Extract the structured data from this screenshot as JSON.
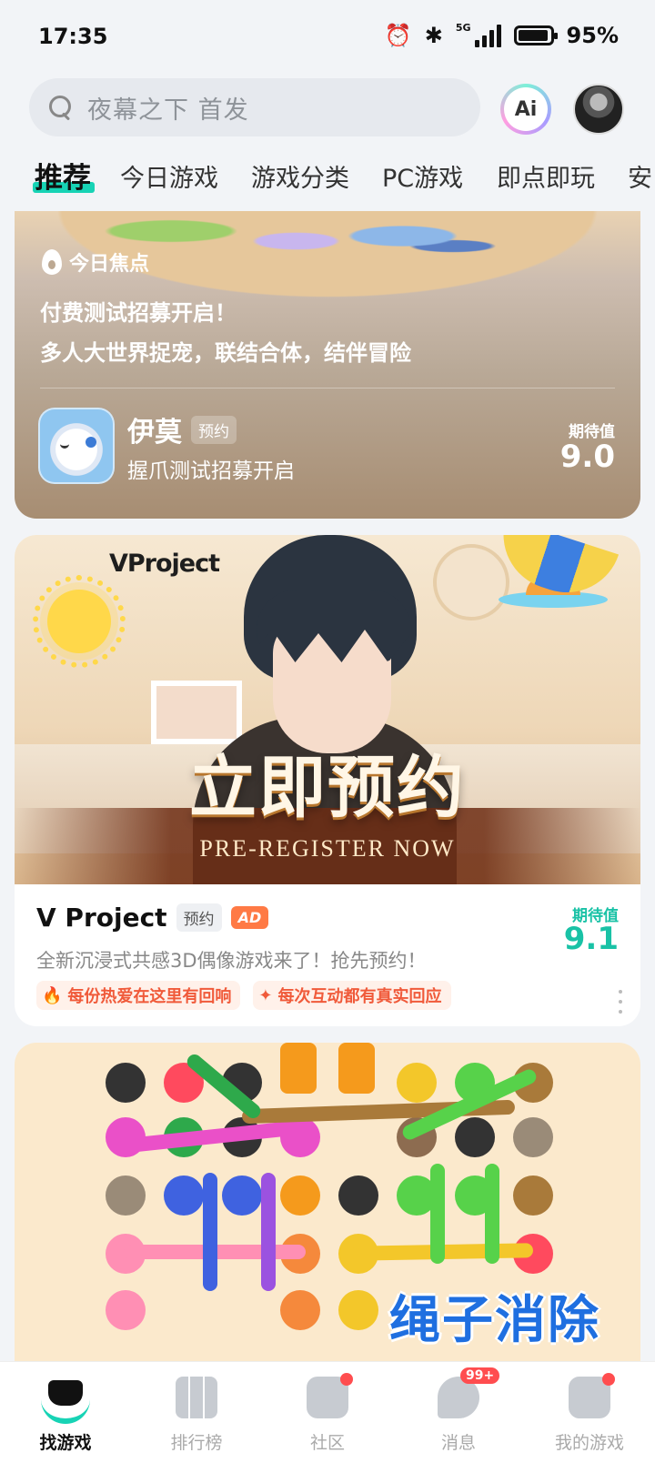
{
  "status_bar": {
    "time": "17:35",
    "network": "5G",
    "battery": "95%",
    "icons": [
      "alarm-icon",
      "bluetooth-icon",
      "signal-icon",
      "battery-icon"
    ]
  },
  "header": {
    "search_placeholder": "夜幕之下 首发",
    "ai_label": "Ai"
  },
  "tabs": [
    {
      "label": "推荐",
      "active": true
    },
    {
      "label": "今日游戏"
    },
    {
      "label": "游戏分类"
    },
    {
      "label": "PC游戏"
    },
    {
      "label": "即点即玩"
    },
    {
      "label": "安"
    }
  ],
  "spotlight_card": {
    "section_label": "今日焦点",
    "headline_1": "付费测试招募开启！",
    "headline_2": "多人大世界捉宠，联结合体，结伴冒险",
    "game_name": "伊莫",
    "tag": "预约",
    "description": "握爪测试招募开启",
    "score_label": "期待值",
    "score": "9.0"
  },
  "ad_card": {
    "banner_logo": "VProject",
    "banner_cta": "立即预约",
    "banner_sub": "PRE-REGISTER NOW",
    "title": "V Project",
    "tag": "预约",
    "ad_badge": "AD",
    "description": "全新沉浸式共感3D偶像游戏来了！抢先预约！",
    "chips": [
      "每份热爱在这里有回响",
      "每次互动都有真实回应"
    ],
    "score_label": "期待值",
    "score": "9.1",
    "accent_color": "#19c2a6"
  },
  "rope_card": {
    "title": "绳子消除"
  },
  "bottom_nav": [
    {
      "label": "找游戏",
      "active": true,
      "icon": "find-game-icon"
    },
    {
      "label": "排行榜",
      "icon": "ranking-icon"
    },
    {
      "label": "社区",
      "icon": "community-icon",
      "dot": true
    },
    {
      "label": "消息",
      "icon": "message-icon",
      "badge": "99+"
    },
    {
      "label": "我的游戏",
      "icon": "my-games-icon",
      "dot": true
    }
  ]
}
